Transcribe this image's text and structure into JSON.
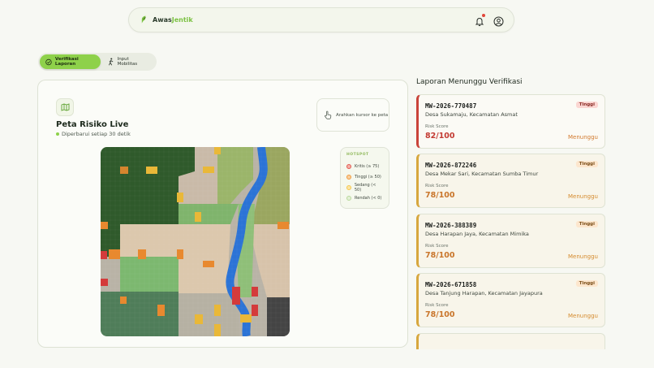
{
  "app": {
    "brand_part1": "Awas",
    "brand_part2": "Jentik",
    "accent": "#8ed14a"
  },
  "header": {
    "icons": [
      "leaf-logo-icon",
      "bell-icon",
      "user-circle-icon"
    ]
  },
  "tabs": [
    {
      "label": "Verifikasi Laporan",
      "icon": "check-circle-icon",
      "active": true
    },
    {
      "label": "Input Mobilitas",
      "icon": "walking-person-icon",
      "active": false
    }
  ],
  "map": {
    "title": "Peta Risiko Live",
    "subtitle": "Diperbarui setiap 30 detik",
    "hint": "Arahkan kursor ke peta",
    "legend": {
      "title": "HOTSPOT",
      "items": [
        {
          "label": "Kritis (≥ 75)",
          "color": "#e35a4f"
        },
        {
          "label": "Tinggi (≥ 50)",
          "color": "#f29a3a"
        },
        {
          "label": "Sedang (< 50)",
          "color": "#f5c84a"
        },
        {
          "label": "Rendah (< 0)",
          "color": "#b8d89a"
        }
      ]
    }
  },
  "panel": {
    "title": "Laporan Menunggu Verifikasi",
    "reports": [
      {
        "code": "MW-2026-770487",
        "location": "Desa Sukamaju, Kecamatan Asmat",
        "score_label": "Risk Score",
        "score": "82/100",
        "badge": "Tinggi",
        "status": "Menunggu"
      },
      {
        "code": "MW-2026-872246",
        "location": "Desa Mekar Sari, Kecamatan Sumba Timur",
        "score_label": "Risk Score",
        "score": "78/100",
        "badge": "Tinggi",
        "status": "Menunggu"
      },
      {
        "code": "MW-2026-388389",
        "location": "Desa Harapan Jaya, Kecamatan Mimika",
        "score_label": "Risk Score",
        "score": "78/100",
        "badge": "Tinggi",
        "status": "Menunggu"
      },
      {
        "code": "MW-2026-671858",
        "location": "Desa Tanjung Harapan, Kecamatan Jayapura",
        "score_label": "Risk Score",
        "score": "78/100",
        "badge": "Tinggi",
        "status": "Menunggu"
      }
    ]
  }
}
